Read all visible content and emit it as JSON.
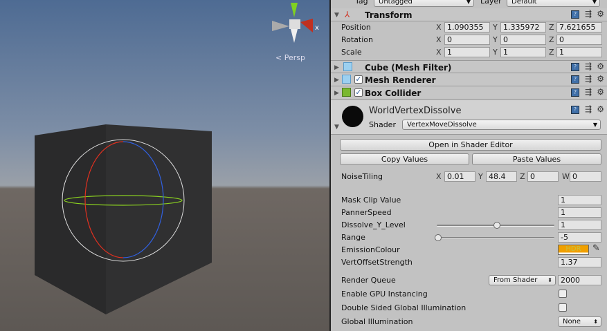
{
  "scene": {
    "persp_label": "Persp",
    "gizmo_axis": "x"
  },
  "top": {
    "tag_label": "Tag",
    "tag_value": "Untagged",
    "layer_label": "Layer",
    "layer_value": "Default"
  },
  "transform": {
    "title": "Transform",
    "rows": [
      {
        "label": "Position",
        "x": "1.090355",
        "y": "1.335972",
        "z": "7.621655"
      },
      {
        "label": "Rotation",
        "x": "0",
        "y": "0",
        "z": "0"
      },
      {
        "label": "Scale",
        "x": "1",
        "y": "1",
        "z": "1"
      }
    ]
  },
  "axes": {
    "x": "X",
    "y": "Y",
    "z": "Z",
    "w": "W"
  },
  "components": [
    {
      "title": "Cube (Mesh Filter)"
    },
    {
      "title": "Mesh Renderer",
      "enabled": true
    },
    {
      "title": "Box Collider",
      "enabled": true
    }
  ],
  "material": {
    "name": "WorldVertexDissolve",
    "shader_label": "Shader",
    "shader_value": "VertexMoveDissolve"
  },
  "buttons": {
    "open_editor": "Open in Shader Editor",
    "copy": "Copy Values",
    "paste": "Paste Values"
  },
  "noise": {
    "label": "NoiseTiling",
    "x": "0.01",
    "y": "48.4",
    "z": "0",
    "w": "0"
  },
  "props": {
    "mask_clip": {
      "label": "Mask Clip Value",
      "value": "1"
    },
    "panner": {
      "label": "PannerSpeed",
      "value": "1"
    },
    "dissolve": {
      "label": "Dissolve_Y_Level",
      "value": "1",
      "slider": 0.5
    },
    "range": {
      "label": "Range",
      "value": "-5",
      "slider": 0
    },
    "emission": {
      "label": "EmissionColour",
      "hdr": "HDR",
      "color": "#f0a000"
    },
    "vert": {
      "label": "VertOffsetStrength",
      "value": "1.37"
    },
    "render_queue": {
      "label": "Render Queue",
      "mode": "From Shader",
      "value": "2000"
    },
    "gpu": {
      "label": "Enable GPU Instancing",
      "checked": false
    },
    "double_sided": {
      "label": "Double Sided Global Illumination",
      "checked": false
    },
    "gi": {
      "label": "Global Illumination",
      "value": "None"
    }
  }
}
